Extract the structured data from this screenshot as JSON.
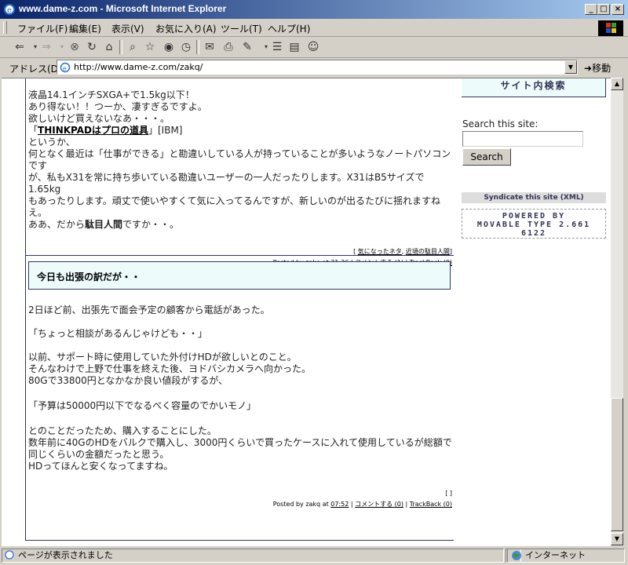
{
  "window": {
    "title": "www.dame-z.com - Microsoft Internet Explorer",
    "minimize": "_",
    "maximize": "□",
    "close": "×"
  },
  "menu": [
    "ファイル(F)",
    "編集(E)",
    "表示(V)",
    "お気に入り(A)",
    "ツール(T)",
    "ヘルプ(H)"
  ],
  "address": {
    "label": "アドレス(D)",
    "url": "http://www.dame-z.com/zakq/",
    "go": "移動"
  },
  "post1": {
    "lines": [
      "液晶14.1インチSXGA+で1.5kg以下！",
      "あり得ない！！つーか、凄すぎるですよ。",
      "欲しいけど買えないなあ・・・。"
    ],
    "link_prefix": "「",
    "link_text": "THINKPADはプロの道具",
    "link_suffix": "」[IBM]",
    "lines2": [
      "というか、",
      "何となく最近は「仕事ができる」と勘違いしている人が持っていることが多いようなノートパソコンです",
      "が、私もX31を常に持ち歩いている勘違いユーザーの一人だったりします。X31はB5サイズで1.65kg",
      "もあったりします。頑丈で使いやすくて気に入ってるんですが、新しいのが出るたびに揺れますねえ。"
    ],
    "last_prefix": "ああ、だから",
    "last_bold": "駄目人間",
    "last_suffix": "ですか・・。",
    "categories_open": "[ ",
    "category1": "気になったネタ",
    "category2": "近頃の駄目人間",
    "categories_close": "]",
    "posted_by": "Posted by zakq at ",
    "time": "21:36",
    "comments": "コメントする (1)",
    "trackback": "TrackBack (0)"
  },
  "post2": {
    "title": "今日も出張の訳だが・・",
    "paragraphs": [
      [
        "2日ほど前、出張先で面会予定の顧客から電話があった。"
      ],
      [
        "「ちょっと相談があるんじゃけども・・」"
      ],
      [
        "以前、サポート時に使用していた外付けHDが欲しいとのこと。",
        "そんなわけで上野で仕事を終えた後、ヨドバシカメラへ向かった。",
        "80Gで33800円となかなか良い値段がするが、"
      ],
      [
        "「予算は50000円以下でなるべく容量のでかいモノ」"
      ],
      [
        "とのことだったため、購入することにした。",
        "数年前に40GのHDをバルクで購入し、3000円くらいで買ったケースに入れて使用しているが総額で",
        "同じくらいの金額だったと思う。",
        "HDってほんと安くなってますね。"
      ]
    ],
    "categories": "[ ]",
    "posted_by": "Posted by zakq at ",
    "time": "07:52",
    "comments": "コメントする (0)",
    "trackback": "TrackBack (0)"
  },
  "sidebar": {
    "search_heading": "サイト内検索",
    "search_label": "Search this site:",
    "search_button": "Search",
    "syndicate": "Syndicate this site (XML)",
    "powered_line1": "POWERED BY",
    "powered_line2": "MOVABLE TYPE 2.661",
    "powered_line3": "6122"
  },
  "status": {
    "message": "ページが表示されました",
    "zone": "インターネット"
  }
}
